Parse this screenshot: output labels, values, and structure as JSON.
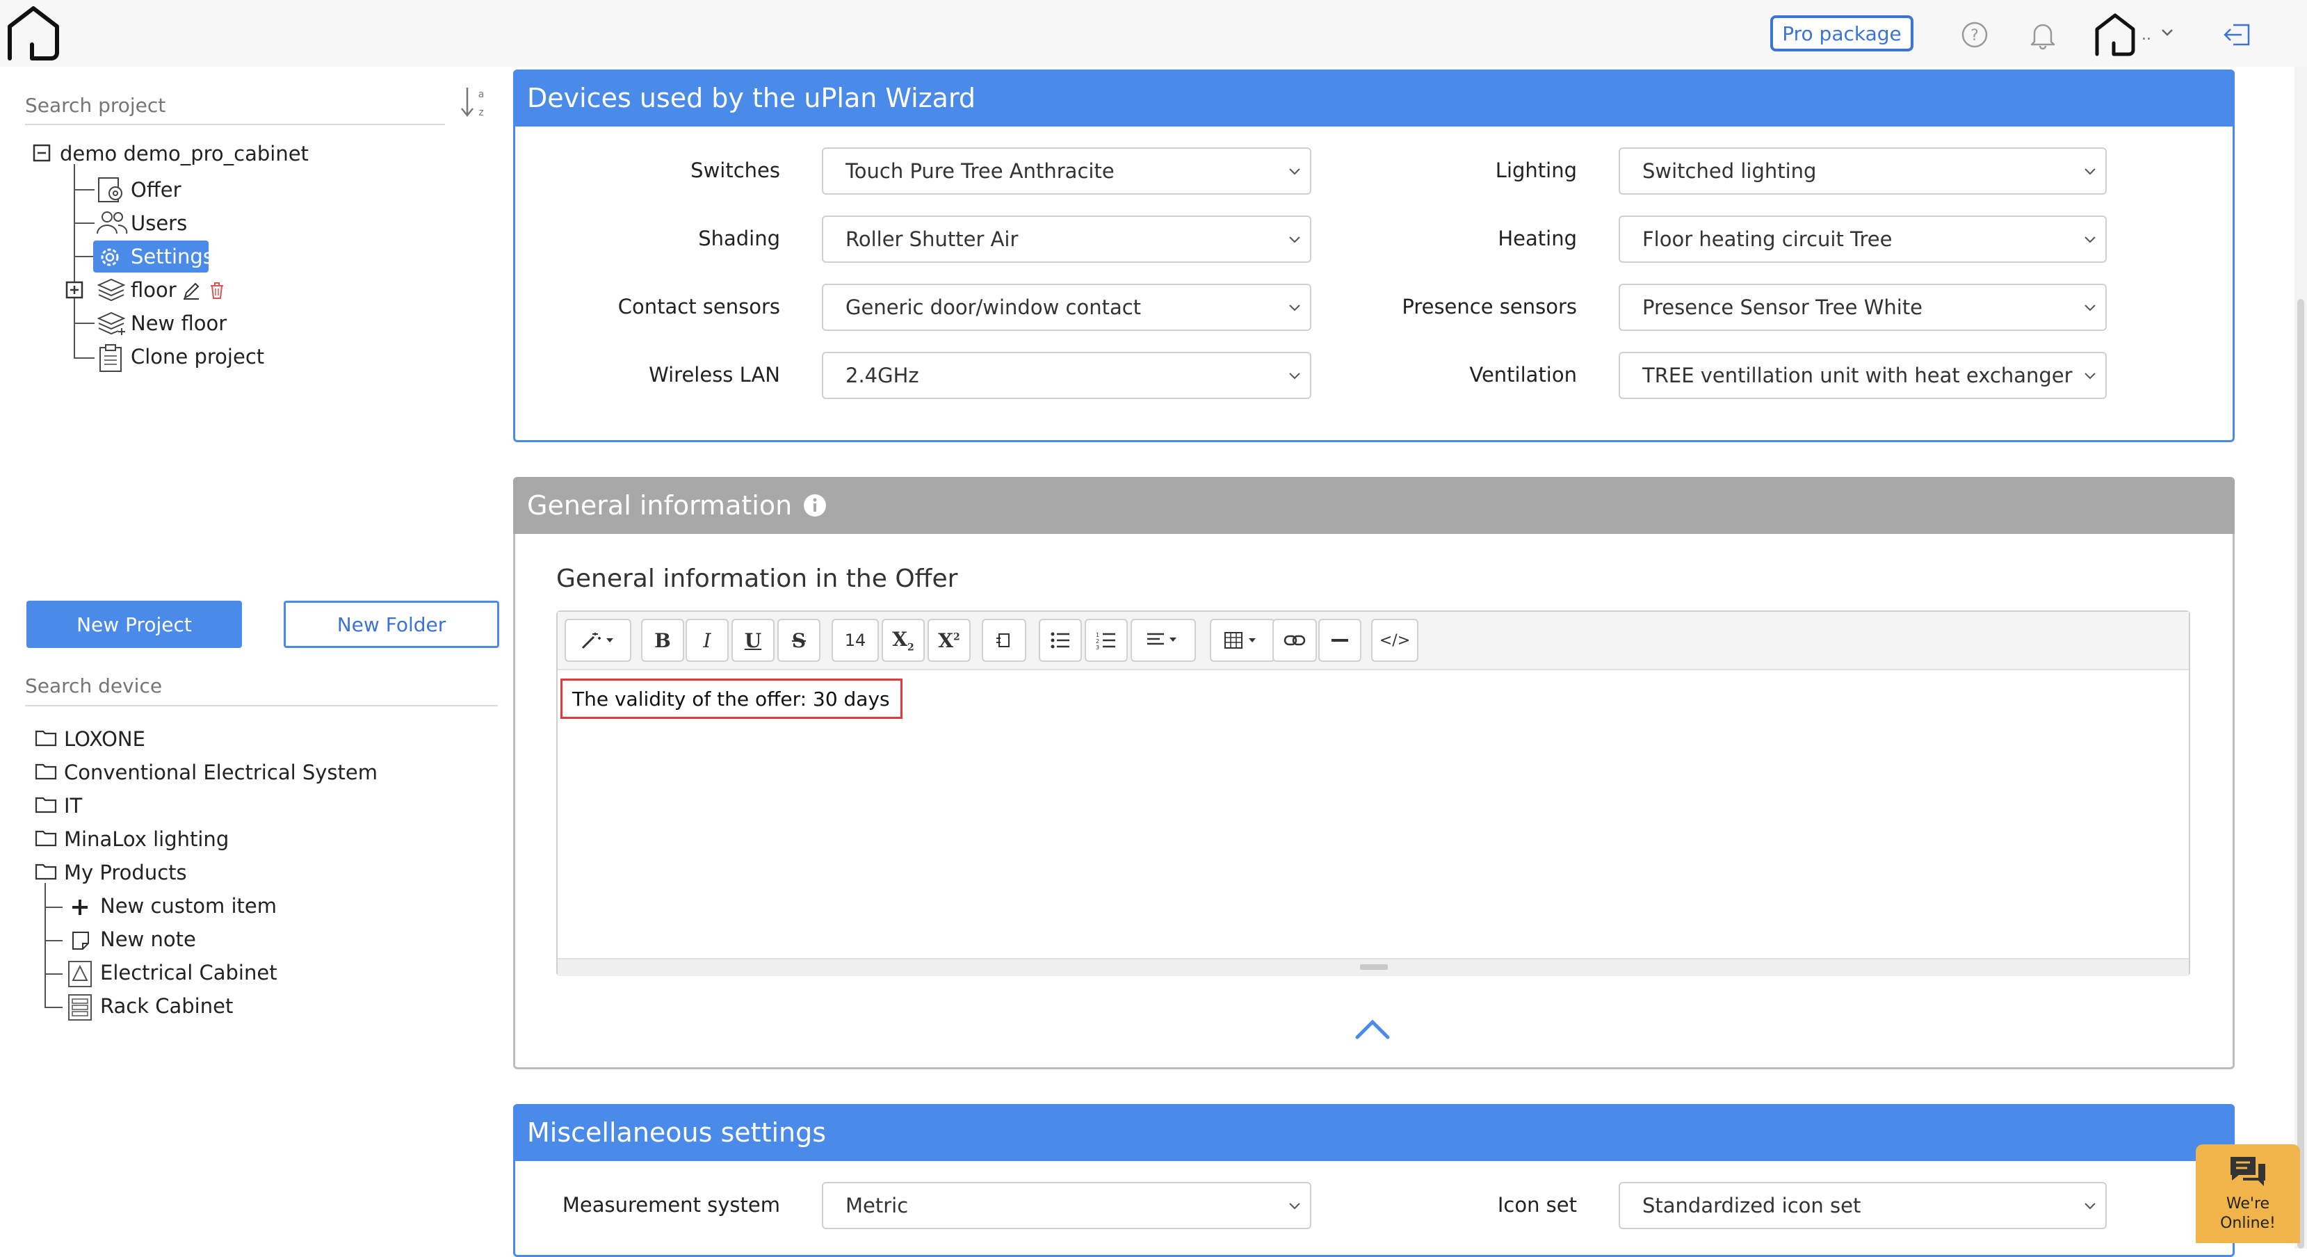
{
  "topbar": {
    "pro_package": "Pro package",
    "user_dots": ".."
  },
  "sidebar": {
    "search_project_placeholder": "Search project",
    "project_root": "demo demo_pro_cabinet",
    "project_items": [
      "Offer",
      "Users",
      "Settings",
      "floor",
      "New floor",
      "Clone project"
    ],
    "new_project": "New Project",
    "new_folder": "New Folder",
    "search_device_placeholder": "Search device",
    "device_folders": [
      "LOXONE",
      "Conventional Electrical System",
      "IT",
      "MinaLox lighting",
      "My Products"
    ],
    "my_products_items": [
      "New custom item",
      "New note",
      "Electrical Cabinet",
      "Rack Cabinet"
    ]
  },
  "devices_panel": {
    "title": "Devices used by the uPlan Wizard",
    "fields": [
      {
        "label": "Switches",
        "value": "Touch Pure Tree Anthracite"
      },
      {
        "label": "Lighting",
        "value": "Switched lighting"
      },
      {
        "label": "Shading",
        "value": "Roller Shutter Air"
      },
      {
        "label": "Heating",
        "value": "Floor heating circuit Tree"
      },
      {
        "label": "Contact sensors",
        "value": "Generic door/window contact"
      },
      {
        "label": "Presence sensors",
        "value": "Presence Sensor Tree White"
      },
      {
        "label": "Wireless LAN",
        "value": "2.4GHz"
      },
      {
        "label": "Ventilation",
        "value": "TREE ventillation unit with heat exchanger (wall"
      }
    ]
  },
  "general_panel": {
    "title": "General information",
    "subtitle": "General information in the Offer",
    "font_size": "14",
    "editor_text": "The validity of the offer: 30 days"
  },
  "misc_panel": {
    "title": "Miscellaneous settings",
    "fields": [
      {
        "label": "Measurement system",
        "value": "Metric"
      },
      {
        "label": "Icon set",
        "value": "Standardized icon set"
      }
    ]
  },
  "chat": {
    "line1": "We're",
    "line2": "Online!"
  },
  "colors": {
    "accent": "#4a8bea",
    "header_grey": "#a8a8a8",
    "highlight_border": "#e23a3a",
    "chat": "#f0b44a"
  },
  "icons": {
    "logo": "house-outline-icon",
    "help": "question-circle-icon",
    "notifications": "bell-icon",
    "logout": "logout-icon",
    "sort": "sort-az-icon",
    "info": "info-circle-icon",
    "collapse": "chevron-up-icon",
    "chat": "chat-bubbles-icon"
  }
}
